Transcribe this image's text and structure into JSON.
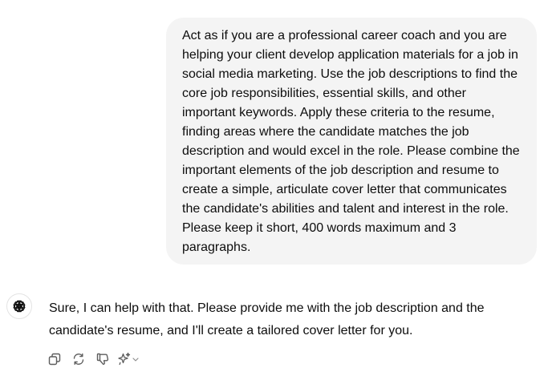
{
  "conversation": {
    "user_message": "Act as if you are a professional career coach and you are helping your client develop application materials for a job in social media marketing. Use the job descriptions to find the core job responsibilities, essential skills, and other important keywords. Apply these criteria to the resume, finding areas where the candidate matches the job description and would excel in the role. Please combine the important elements of the job description and resume to create a simple, articulate cover letter that communicates the candidate's abilities and talent and interest in the role. Please keep it short, 400 words maximum and 3 paragraphs.",
    "assistant_message": "Sure, I can help with that. Please provide me with the job description and the candidate's resume, and I'll create a tailored cover letter for you."
  },
  "icons": {
    "avatar": "openai-logo-icon",
    "copy": "copy-icon",
    "regenerate": "regenerate-icon",
    "dislike": "thumbs-down-icon",
    "model_switch": "sparkle-icon",
    "chevron": "chevron-down-icon"
  },
  "colors": {
    "user_bubble_bg": "#f4f4f4",
    "text": "#0d0d0d",
    "icon": "#5d5d5d"
  }
}
